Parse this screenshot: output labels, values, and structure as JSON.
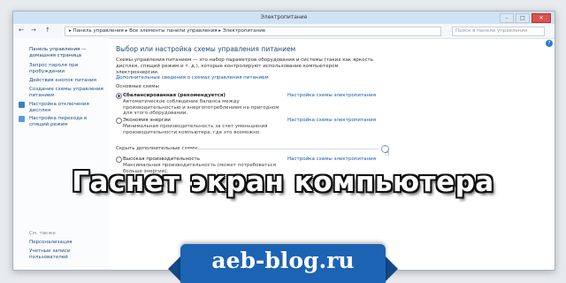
{
  "window": {
    "title": "Электропитание",
    "controls": [
      "–",
      "□",
      "✕"
    ]
  },
  "addressbar": {
    "back": "←",
    "forward": "→",
    "up": "↑",
    "path": "▸ Панель управления ▸ Все элементы панели управления ▸ Электропитание",
    "search_placeholder": "Поиск в панели управления"
  },
  "sidebar": {
    "items": [
      "Панель управления — домашняя страница",
      "Запрос пароля при пробуждении",
      "Действия кнопок питания",
      "Создание схемы управления питанием",
      "Настройка отключения дисплея",
      "Настройка перехода в спящий режим"
    ],
    "see_also_label": "См. также",
    "see_also_items": [
      "Персонализация",
      "Учетные записи пользователей"
    ]
  },
  "main": {
    "heading": "Выбор или настройка схемы управления питанием",
    "description": "Схемы управления питанием — это набор параметров оборудования и системы (таких как яркость дисплея, спящий режим и т. д.), которые контролируют использование компьютером электроэнергии.",
    "more_link": "Дополнительные сведения о схемах управления питанием",
    "selected_plans_label": "Основные схемы",
    "hidden_plans_label": "Скрыть дополнительные схемы",
    "plans": [
      {
        "name": "Сбалансированная (рекомендуется)",
        "desc": "Автоматическое соблюдение баланса между производительностью и энергопотреблением на пригодном для этого оборудовании.",
        "link": "Настройка схемы электропитания",
        "selected": true
      },
      {
        "name": "Экономия энергии",
        "desc": "Минимальная производительность за счет уменьшения производительности компьютера, где это возможно.",
        "link": "Настройка схемы электропитания",
        "selected": false
      },
      {
        "name": "Высокая производительность",
        "desc": "Максимальная производительность (может потребоваться больше энергии).",
        "link": "Настройка схемы электропитания",
        "selected": false
      }
    ]
  },
  "overlay": {
    "title": "Гаснет экран компьютера",
    "site": "aeb-blog.ru"
  },
  "colors": {
    "accent": "#1c63b4",
    "link": "#0b5cad"
  }
}
